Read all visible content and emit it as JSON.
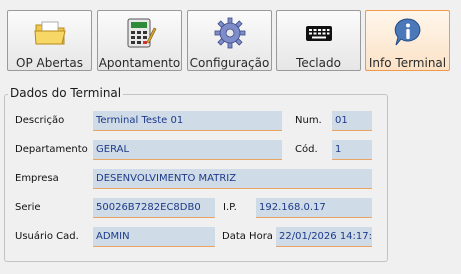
{
  "toolbar": {
    "op_abertas": "OP Abertas",
    "apontamento": "Apontamento",
    "configuracao": "Configuração",
    "teclado": "Teclado",
    "info_terminal": "Info Terminal"
  },
  "icons": {
    "op_abertas": "folder-icon",
    "apontamento": "calculator-icon",
    "configuracao": "gear-icon",
    "teclado": "keyboard-icon",
    "info_terminal": "info-icon"
  },
  "colors": {
    "active_border": "#ee9a4c",
    "field_bg": "#cfdbe6",
    "field_text": "#1d3a8a",
    "field_underline": "#e9a464"
  },
  "terminal": {
    "group_title": "Dados do Terminal",
    "labels": {
      "descricao": "Descrição",
      "num": "Num.",
      "departamento": "Departamento",
      "cod": "Cód.",
      "empresa": "Empresa",
      "serie": "Serie",
      "ip": "I.P.",
      "usuario": "Usuário Cad.",
      "data_hora": "Data Hora"
    },
    "values": {
      "descricao": "Terminal Teste 01",
      "num": "01",
      "departamento": "GERAL",
      "cod": "1",
      "empresa": "DESENVOLVIMENTO MATRIZ",
      "serie": "50026B7282EC8DB0",
      "ip": "192.168.0.17",
      "usuario": "ADMIN",
      "data_hora": "22/01/2026 14:17:"
    }
  }
}
